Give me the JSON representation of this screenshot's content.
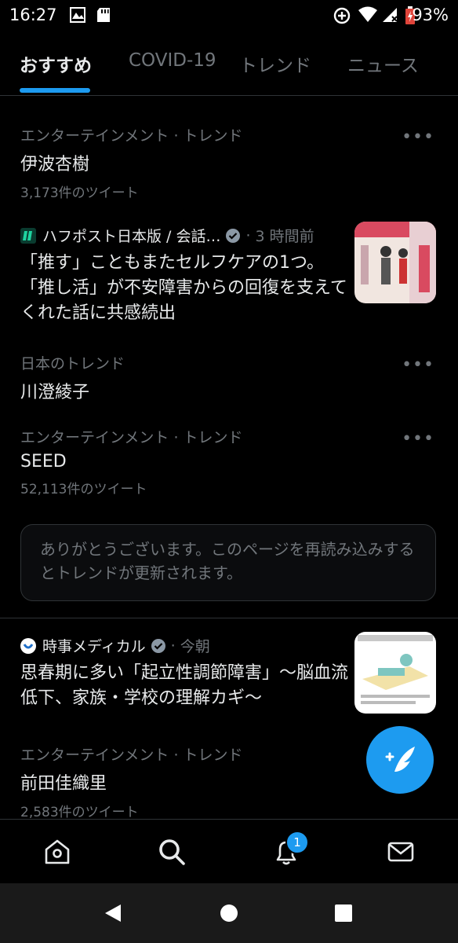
{
  "status_bar": {
    "time": "16:27",
    "battery": "93%"
  },
  "tabs": [
    {
      "label": "おすすめ",
      "active": true
    },
    {
      "label": "COVID-19",
      "active": false
    },
    {
      "label": "トレンド",
      "active": false
    },
    {
      "label": "ニュース",
      "active": false
    }
  ],
  "trends": [
    {
      "meta": "エンターテインメント · トレンド",
      "name": "伊波杏樹",
      "count": "3,173件のツイート"
    },
    {
      "meta": "日本のトレンド",
      "name": "川澄綾子",
      "count": ""
    },
    {
      "meta": "エンターテインメント · トレンド",
      "name": "SEED",
      "count": "52,113件のツイート"
    },
    {
      "meta": "エンターテインメント · トレンド",
      "name": "前田佳織里",
      "count": "2,583件のツイート"
    }
  ],
  "news": [
    {
      "source": "ハフポスト日本版 / 会話…",
      "time": "3 時間前",
      "headline": "「推す」こともまたセルフケアの1つ。「推し活」が不安障害からの回復を支えてくれた話に共感続出",
      "logo_color": "#1ed4a0"
    },
    {
      "source": "時事メディカル",
      "time": "今朝",
      "headline": "思春期に多い「起立性調節障害」～脳血流低下、家族・学校の理解カギ～",
      "logo_color": "#ffffff"
    }
  ],
  "notice": "ありがとうございます。このページを再読み込みするとトレンドが更新されます。",
  "more_label": "•••",
  "dot": "·",
  "notification_badge": "1",
  "colors": {
    "accent": "#1d9bf0",
    "background": "#000000",
    "muted": "#71767b"
  }
}
